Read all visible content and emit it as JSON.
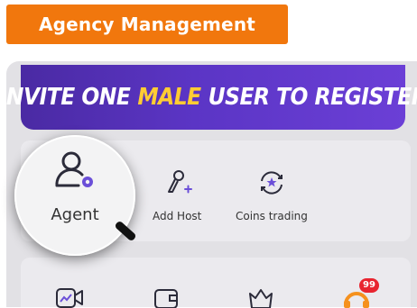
{
  "header": {
    "title": "Agency Management"
  },
  "banner": {
    "before": "INVITE ONE",
    "highlight": "MALE",
    "after": "USER TO REGISTER"
  },
  "grid": {
    "row1": [
      {
        "label": "Agent",
        "icon": "agent-icon"
      },
      {
        "label": "Add Host",
        "icon": "add-host-icon"
      },
      {
        "label": "Coins trading",
        "icon": "coins-trading-icon"
      }
    ],
    "row2_icons": [
      "video-stats-icon",
      "wallet-icon",
      "crown-icon",
      "support-headset-icon"
    ],
    "notification_badge": "99"
  },
  "colors": {
    "accent": "#f1770d",
    "banner": "#5b35c5",
    "icon": "#2b2b3a",
    "highlight": "#ffcc33",
    "badge": "#e8242f"
  }
}
